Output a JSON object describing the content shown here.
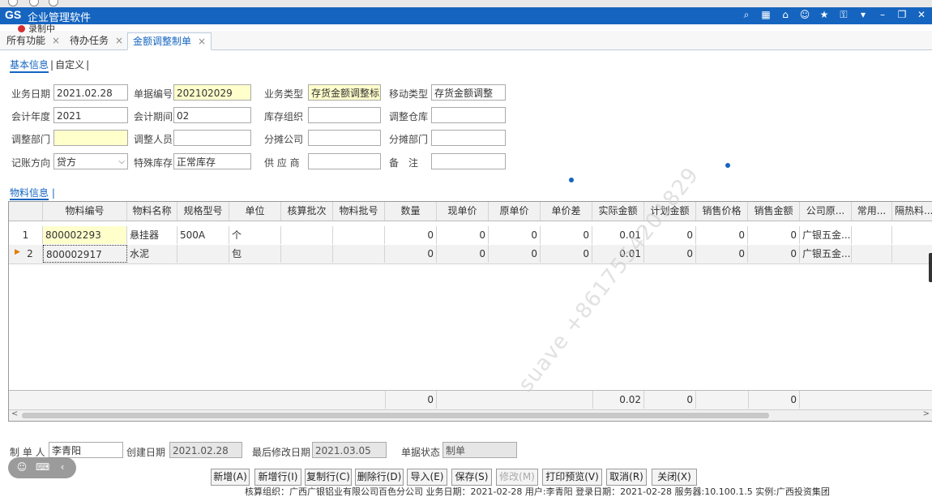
{
  "app": {
    "logo": "GS",
    "title": "企业管理软件",
    "recording": "录制中"
  },
  "tabs": [
    {
      "label": "所有功能",
      "close": "×"
    },
    {
      "label": "待办任务",
      "close": "×"
    },
    {
      "label": "金额调整制单",
      "close": "×"
    }
  ],
  "subtabs": {
    "basic": "基本信息",
    "custom": "自定义"
  },
  "form": {
    "biz_date_label": "业务日期",
    "biz_date": "2021.02.28",
    "doc_no_label": "单据编号",
    "doc_no": "202102029",
    "biz_type_label": "业务类型",
    "biz_type": "存货金额调整标准",
    "move_type_label": "移动类型",
    "move_type": "存货金额调整",
    "fiscal_year_label": "会计年度",
    "fiscal_year": "2021",
    "fiscal_period_label": "会计期间",
    "fiscal_period": "02",
    "stock_org_label": "库存组织",
    "stock_org": "",
    "adjust_wh_label": "调整仓库",
    "adjust_wh": "",
    "adjust_dept_label": "调整部门",
    "adjust_dept": "",
    "adjust_person_label": "调整人员",
    "adjust_person": "",
    "alloc_company_label": "分摊公司",
    "alloc_company": "",
    "alloc_dept_label": "分摊部门",
    "alloc_dept": "",
    "direction_label": "记账方向",
    "direction": "贷方",
    "special_stock_label": "特殊库存",
    "special_stock": "正常库存",
    "supplier_label": "供 应 商",
    "supplier": "",
    "remark_label": "备　注",
    "remark": ""
  },
  "material_section": "物料信息",
  "grid": {
    "headers": [
      "物料编号",
      "物料名称",
      "规格型号",
      "单位",
      "核算批次",
      "物料批号",
      "数量",
      "现单价",
      "原单价",
      "单价差",
      "实际金额",
      "计划金额",
      "销售价格",
      "销售金额",
      "公司原...",
      "常用...",
      "隔热料..."
    ],
    "rows": [
      {
        "idx": "1",
        "marker": "",
        "cells": [
          "800002293",
          "悬挂器",
          "500A",
          "个",
          "",
          "",
          "0",
          "0",
          "0",
          "0",
          "0.01",
          "0",
          "0",
          "0",
          "广银五金...",
          "",
          ""
        ]
      },
      {
        "idx": "2",
        "marker": "▶",
        "cells": [
          "800002917",
          "水泥",
          "",
          "包",
          "",
          "",
          "0",
          "0",
          "0",
          "0",
          "0.01",
          "0",
          "0",
          "0",
          "广银五金...",
          "",
          ""
        ]
      }
    ],
    "totals": {
      "qty": "0",
      "actual_amount": "0.02",
      "plan_amount": "0",
      "sales_amount": "0"
    }
  },
  "footer": {
    "creator_label": "制 单 人",
    "creator": "李青阳",
    "created_label": "创建日期",
    "created": "2021.02.28",
    "modified_label": "最后修改日期",
    "modified": "2021.03.05",
    "status_label": "单据状态",
    "status": "制单"
  },
  "buttons": {
    "add": "新增(A)",
    "add_row": "新增行(I)",
    "copy_row": "复制行(C)",
    "del_row": "删除行(D)",
    "import": "导入(E)",
    "save": "保存(S)",
    "modify": "修改(M)",
    "print": "打印预览(V)",
    "cancel": "取消(R)",
    "close": "关闭(X)"
  },
  "statusbar": "核算组织：广西广银铝业有限公司百色分公司 业务日期：2021-02-28 用户:李青阳 登录日期：2021-02-28 服务器:10.100.1.5 实例:广西投资集团",
  "watermark": "suave +8617554201829",
  "colors": {
    "titlebar": "#1565c0",
    "yellow_field": "#ffffcc",
    "accent": "#1565c0"
  }
}
